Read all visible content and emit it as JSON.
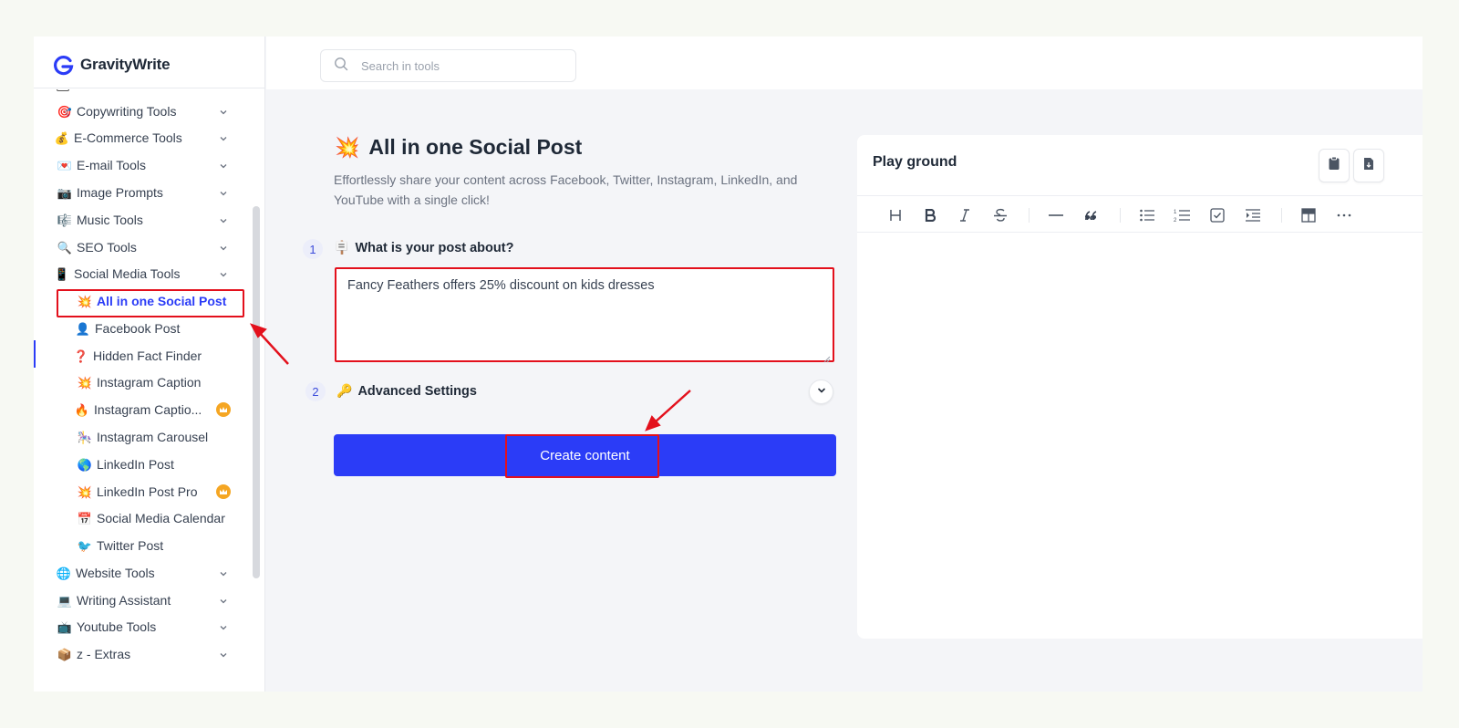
{
  "brand": {
    "name": "GravityWrite"
  },
  "search": {
    "placeholder": "Search in tools"
  },
  "sidebar": {
    "categories_top": [
      {
        "emoji": "🎯",
        "label": "Copywriting Tools"
      },
      {
        "emoji": "💰",
        "label": "E-Commerce Tools"
      },
      {
        "emoji": "💌",
        "label": "E-mail Tools"
      },
      {
        "emoji": "📷",
        "label": "Image Prompts"
      },
      {
        "emoji": "🎼",
        "label": "Music Tools"
      },
      {
        "emoji": "🔍",
        "label": "SEO Tools"
      },
      {
        "emoji": "📱",
        "label": "Social Media Tools"
      }
    ],
    "social_items": [
      {
        "emoji": "💥",
        "label": "All in one Social Post",
        "active": true
      },
      {
        "emoji": "👤",
        "label": "Facebook Post"
      },
      {
        "emoji": "❓",
        "label": "Hidden Fact Finder"
      },
      {
        "emoji": "💥",
        "label": "Instagram Caption"
      },
      {
        "emoji": "🔥",
        "label": "Instagram Captio...",
        "premium": true
      },
      {
        "emoji": "🎠",
        "label": "Instagram Carousel"
      },
      {
        "emoji": "🌎",
        "label": "LinkedIn Post"
      },
      {
        "emoji": "💥",
        "label": "LinkedIn Post Pro",
        "premium": true
      },
      {
        "emoji": "📅",
        "label": "Social Media Calendar"
      },
      {
        "emoji": "🐦",
        "label": "Twitter Post"
      }
    ],
    "categories_bottom": [
      {
        "emoji": "🌐",
        "label": "Website Tools"
      },
      {
        "emoji": "💻",
        "label": "Writing Assistant"
      },
      {
        "emoji": "📺",
        "label": "Youtube Tools"
      },
      {
        "emoji": "📦",
        "label": "z - Extras"
      }
    ]
  },
  "main": {
    "title_emoji": "💥",
    "title": "All in one Social Post",
    "subtitle": "Effortlessly share your content across Facebook, Twitter, Instagram, LinkedIn, and YouTube with a single click!",
    "step1": {
      "number": "1",
      "emoji": "🪧",
      "label": "What is your post about?",
      "value": "Fancy Feathers offers 25% discount on kids dresses"
    },
    "step2": {
      "number": "2",
      "emoji": "🔑",
      "label": "Advanced Settings"
    },
    "create_button": "Create content"
  },
  "playground": {
    "title": "Play ground",
    "toolbar": [
      "heading",
      "bold",
      "italic",
      "strikethrough",
      "horizontal-rule",
      "blockquote",
      "bullet-list",
      "ordered-list",
      "task-list",
      "indent",
      "table",
      "more"
    ]
  },
  "colors": {
    "accent": "#2b3cf7",
    "annotation": "#e3101c",
    "premium": "#f5a623"
  }
}
